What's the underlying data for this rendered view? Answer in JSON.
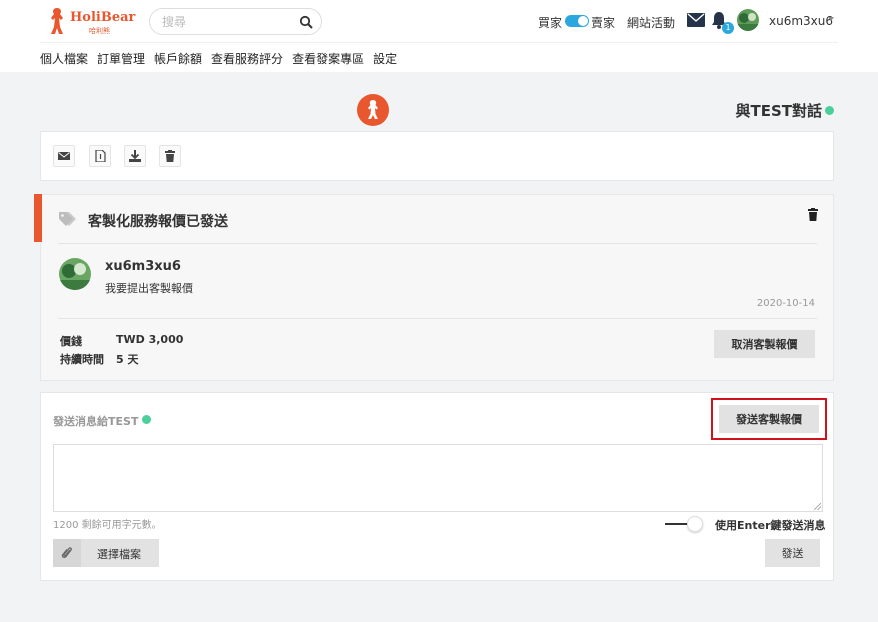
{
  "header": {
    "brand": "HoliBear",
    "brand_sub": "哈利熊",
    "search_placeholder": "搜尋",
    "buyer_label": "買家",
    "seller_label": "賣家",
    "activity_label": "網站活動",
    "notification_count": "1",
    "username": "xu6m3xu6"
  },
  "subnav": {
    "items": [
      "個人檔案",
      "訂單管理",
      "帳戶餘額",
      "查看服務評分",
      "查看發案專區",
      "設定"
    ]
  },
  "chat": {
    "title": "與TEST對話"
  },
  "quote": {
    "title": "客製化服務報價已發送",
    "user": "xu6m3xu6",
    "message": "我要提出客製報價",
    "date": "2020-10-14",
    "price_label": "價錢",
    "price_value": "TWD 3,000",
    "duration_label": "持續時間",
    "duration_value": "5 天",
    "cancel_label": "取消客製報價"
  },
  "composer": {
    "label": "發送消息給TEST",
    "send_quote_label": "發送客製報價",
    "remaining": "1200 剩餘可用字元數。",
    "enter_label": "使用Enter鍵發送消息",
    "file_label": "選擇檔案",
    "submit_label": "發送"
  },
  "colors": {
    "brand": "#e8572d",
    "online": "#4ccf9a",
    "toggle": "#2aa7dc",
    "highlight": "#d0131a"
  }
}
